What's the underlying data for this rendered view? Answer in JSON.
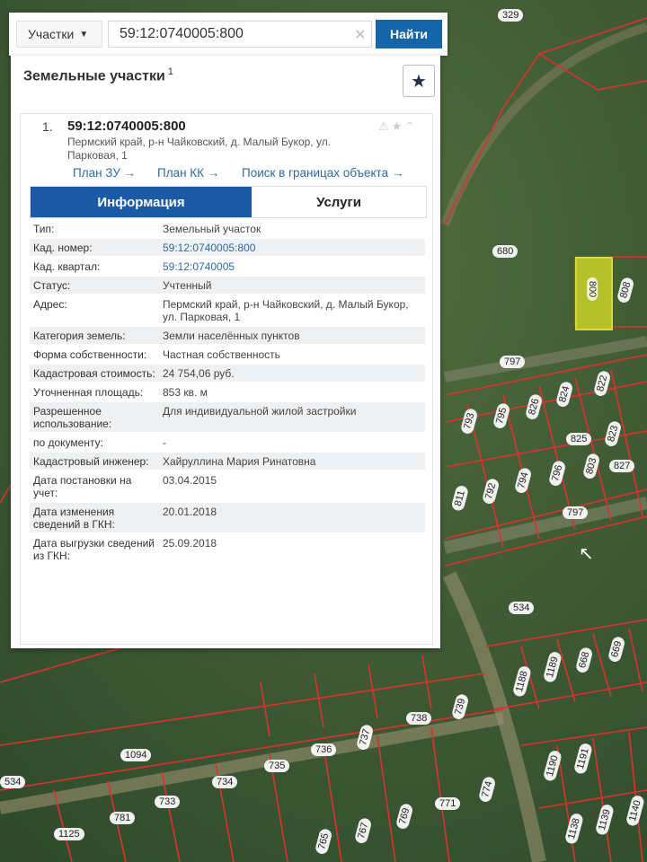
{
  "search": {
    "type_label": "Участки",
    "query": "59:12:0740005:800",
    "button_label": "Найти"
  },
  "panel": {
    "title": "Земельные участки",
    "title_sup": "1",
    "result_index": "1.",
    "cad_number": "59:12:0740005:800",
    "address_line": "Пермский край, р-н Чайковский, д. Малый Букор, ул. Парковая, 1",
    "links": {
      "plan_zu": "План ЗУ →",
      "plan_kk": "План КК →",
      "search_bounds": "Поиск в границах объекта →"
    },
    "tabs": {
      "info": "Информация",
      "services": "Услуги"
    },
    "rows": [
      {
        "k": "Тип:",
        "v": "Земельный участок"
      },
      {
        "k": "Кад. номер:",
        "v": "59:12:0740005:800"
      },
      {
        "k": "Кад. квартал:",
        "v": "59:12:0740005"
      },
      {
        "k": "Статус:",
        "v": "Учтенный"
      },
      {
        "k": "Адрес:",
        "v": "Пермский край, р-н Чайковский, д. Малый Букор, ул. Парковая, 1"
      },
      {
        "k": "Категория земель:",
        "v": "Земли населённых пунктов"
      },
      {
        "k": "Форма собственности:",
        "v": "Частная собственность"
      },
      {
        "k": "Кадастровая стоимость:",
        "v": "24 754,06 руб."
      },
      {
        "k": "Уточненная площадь:",
        "v": "853 кв. м"
      },
      {
        "k": "Разрешенное использование:",
        "v": "Для индивидуальной жилой застройки"
      },
      {
        "k": "по документу:",
        "v": "-"
      },
      {
        "k": "Кадастровый инженер:",
        "v": "Хайруллина Мария Ринатовна"
      },
      {
        "k": "Дата постановки на учет:",
        "v": "03.04.2015"
      },
      {
        "k": "Дата изменения сведений в ГКН:",
        "v": "20.01.2018"
      },
      {
        "k": "Дата выгрузки сведений из ГКН:",
        "v": "25.09.2018"
      }
    ]
  },
  "map": {
    "highlight_label": "800",
    "labels": [
      "329",
      "680",
      "808",
      "797",
      "824",
      "826",
      "822",
      "793",
      "795",
      "825",
      "827",
      "823",
      "811",
      "792",
      "794",
      "796",
      "803",
      "797",
      "534",
      "669",
      "668",
      "1189",
      "1188",
      "738",
      "739",
      "736",
      "737",
      "735",
      "734",
      "733",
      "781",
      "1094",
      "1125",
      "1190",
      "1191",
      "1139",
      "1138",
      "1140",
      "771",
      "774",
      "769",
      "765",
      "767",
      "534"
    ]
  },
  "colors": {
    "accent": "#1565a9",
    "tab_active": "#1b5aa5",
    "link": "#2e6aa8",
    "parcel_line": "#e0302e"
  }
}
